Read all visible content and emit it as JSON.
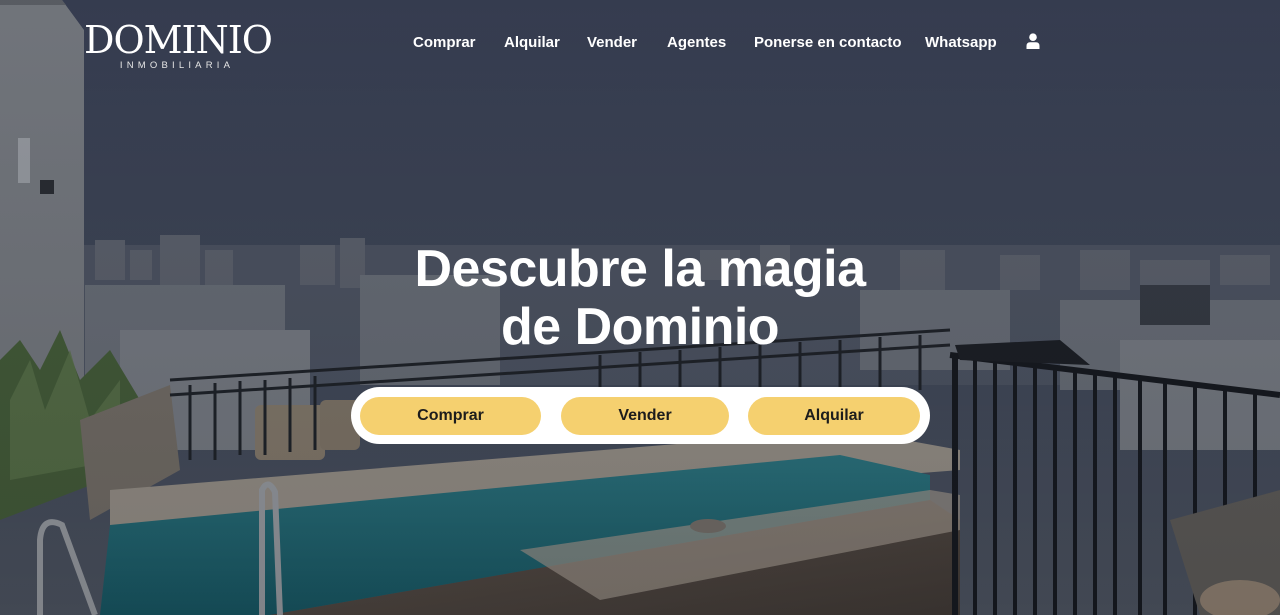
{
  "brand": {
    "name": "DOMINIO",
    "tagline": "INMOBILIARIA"
  },
  "nav": {
    "items": [
      {
        "label": "Comprar"
      },
      {
        "label": "Alquilar"
      },
      {
        "label": "Vender"
      },
      {
        "label": "Agentes"
      },
      {
        "label": "Ponerse en contacto"
      },
      {
        "label": "Whatsapp"
      }
    ],
    "account_icon": "user-icon"
  },
  "hero": {
    "headline_line1": "Descubre la magia",
    "headline_line2": "de Dominio",
    "actions": [
      {
        "label": "Comprar"
      },
      {
        "label": "Vender"
      },
      {
        "label": "Alquilar"
      }
    ]
  },
  "colors": {
    "accent": "#f5d06f",
    "cta_bar": "#ffffff",
    "text": "#ffffff"
  }
}
